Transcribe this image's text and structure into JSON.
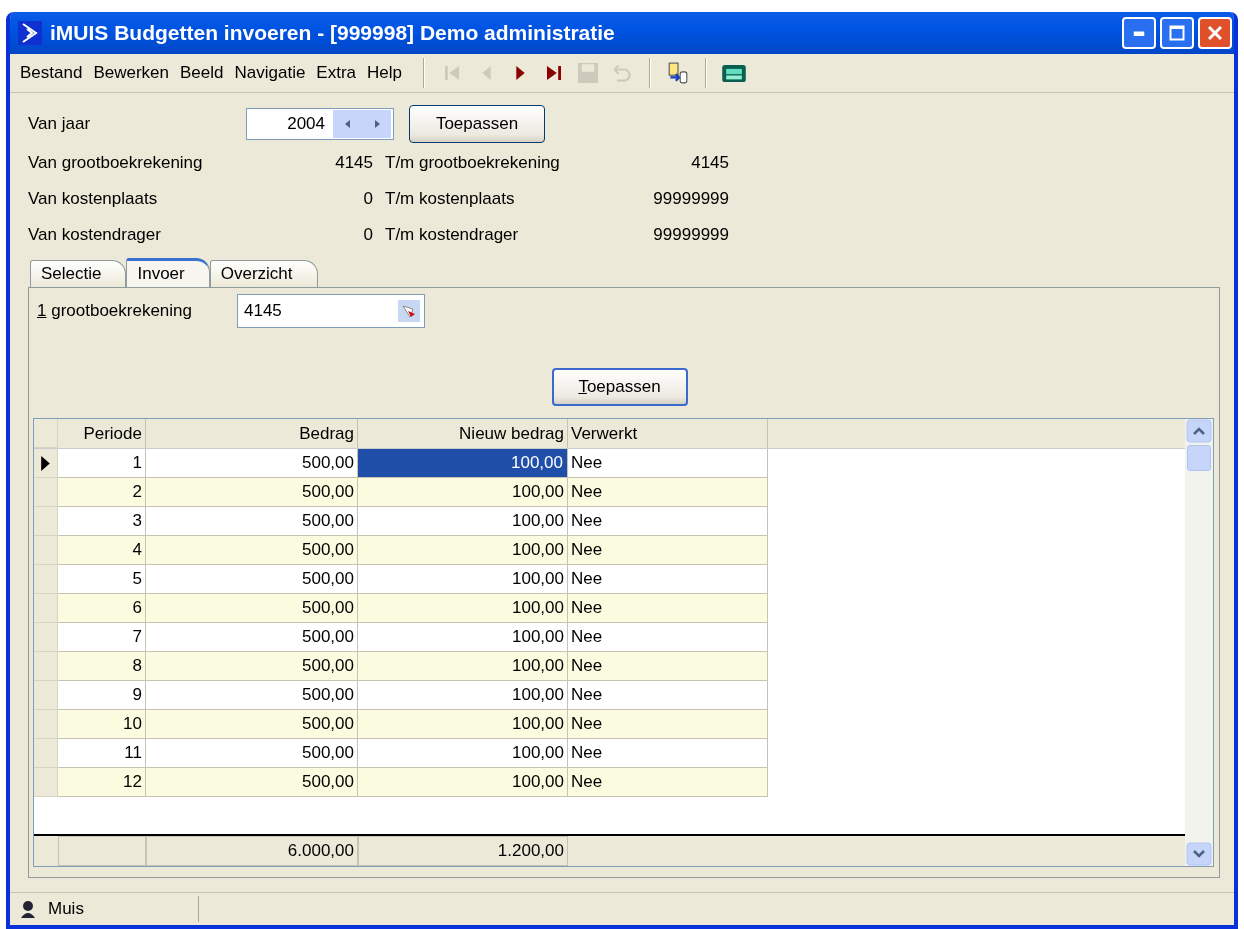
{
  "window": {
    "title": "iMUIS Budgetten invoeren - [999998] Demo administratie"
  },
  "menu": [
    "Bestand",
    "Bewerken",
    "Beeld",
    "Navigatie",
    "Extra",
    "Help"
  ],
  "toolbar": [
    {
      "kind": "first",
      "disabled": true
    },
    {
      "kind": "prev",
      "disabled": true
    },
    {
      "kind": "next",
      "disabled": false
    },
    {
      "kind": "last",
      "disabled": false
    },
    {
      "kind": "save",
      "disabled": true
    },
    {
      "kind": "undo",
      "disabled": true
    },
    {
      "kind": "export",
      "disabled": false
    },
    {
      "kind": "calculator",
      "disabled": false
    }
  ],
  "year": {
    "label": "Van jaar",
    "value": "2004",
    "button": "Toepassen"
  },
  "ranges": [
    {
      "from_label": "Van grootboekrekening",
      "from": "4145",
      "to_label": "T/m grootboekrekening",
      "to": "4145"
    },
    {
      "from_label": "Van kostenplaats",
      "from": "0",
      "to_label": "T/m kostenplaats",
      "to": "99999999"
    },
    {
      "from_label": "Van kostendrager",
      "from": "0",
      "to_label": "T/m kostendrager",
      "to": "99999999"
    }
  ],
  "tabs": [
    {
      "label": "Selectie",
      "selected": false
    },
    {
      "label": "Invoer",
      "selected": true
    },
    {
      "label": "Overzicht",
      "selected": false
    }
  ],
  "invoer": {
    "mnemonic": "1",
    "label": " grootboekrekening",
    "value": "4145",
    "button_mnemonic": "T",
    "button_rest": "oepassen"
  },
  "table": {
    "columns": [
      "Periode",
      "Bedrag",
      "Nieuw bedrag",
      "Verwerkt"
    ],
    "rows": [
      {
        "periode": "1",
        "bedrag": "500,00",
        "nieuw_bedrag": "100,00",
        "verwerkt": "Nee",
        "selected": true
      },
      {
        "periode": "2",
        "bedrag": "500,00",
        "nieuw_bedrag": "100,00",
        "verwerkt": "Nee",
        "selected": false
      },
      {
        "periode": "3",
        "bedrag": "500,00",
        "nieuw_bedrag": "100,00",
        "verwerkt": "Nee",
        "selected": false
      },
      {
        "periode": "4",
        "bedrag": "500,00",
        "nieuw_bedrag": "100,00",
        "verwerkt": "Nee",
        "selected": false
      },
      {
        "periode": "5",
        "bedrag": "500,00",
        "nieuw_bedrag": "100,00",
        "verwerkt": "Nee",
        "selected": false
      },
      {
        "periode": "6",
        "bedrag": "500,00",
        "nieuw_bedrag": "100,00",
        "verwerkt": "Nee",
        "selected": false
      },
      {
        "periode": "7",
        "bedrag": "500,00",
        "nieuw_bedrag": "100,00",
        "verwerkt": "Nee",
        "selected": false
      },
      {
        "periode": "8",
        "bedrag": "500,00",
        "nieuw_bedrag": "100,00",
        "verwerkt": "Nee",
        "selected": false
      },
      {
        "periode": "9",
        "bedrag": "500,00",
        "nieuw_bedrag": "100,00",
        "verwerkt": "Nee",
        "selected": false
      },
      {
        "periode": "10",
        "bedrag": "500,00",
        "nieuw_bedrag": "100,00",
        "verwerkt": "Nee",
        "selected": false
      },
      {
        "periode": "11",
        "bedrag": "500,00",
        "nieuw_bedrag": "100,00",
        "verwerkt": "Nee",
        "selected": false
      },
      {
        "periode": "12",
        "bedrag": "500,00",
        "nieuw_bedrag": "100,00",
        "verwerkt": "Nee",
        "selected": false
      }
    ],
    "totals": {
      "bedrag": "6.000,00",
      "nieuw_bedrag": "1.200,00"
    }
  },
  "status_bar": {
    "user": "Muis"
  }
}
